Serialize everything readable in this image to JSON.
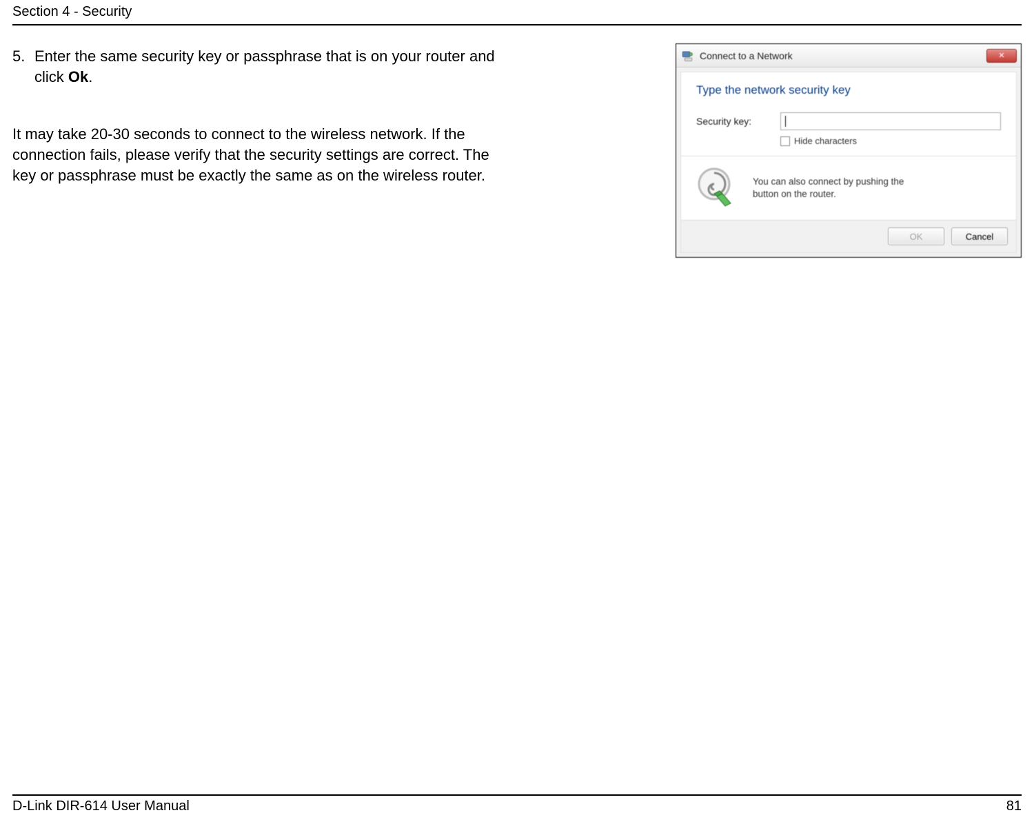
{
  "header": {
    "section_title": "Section 4 - Security"
  },
  "step": {
    "number": "5.",
    "text_before_bold": "Enter the same security key or passphrase that is on your router and click ",
    "bold": "Ok",
    "text_after_bold": "."
  },
  "paragraph": "It may take 20-30 seconds to connect to the wireless network. If the connection fails, please verify that the security settings are correct. The key or passphrase must be exactly the same as on the wireless router.",
  "dialog": {
    "title": "Connect to a Network",
    "close_glyph": "✕",
    "heading": "Type the network security key",
    "field_label": "Security key:",
    "field_value": "",
    "hide_checkbox_label": "Hide characters",
    "wps_line1": "You can also connect by pushing the",
    "wps_line2": "button on the router.",
    "ok_label": "OK",
    "cancel_label": "Cancel"
  },
  "footer": {
    "manual": "D-Link DIR-614 User Manual",
    "page": "81"
  }
}
